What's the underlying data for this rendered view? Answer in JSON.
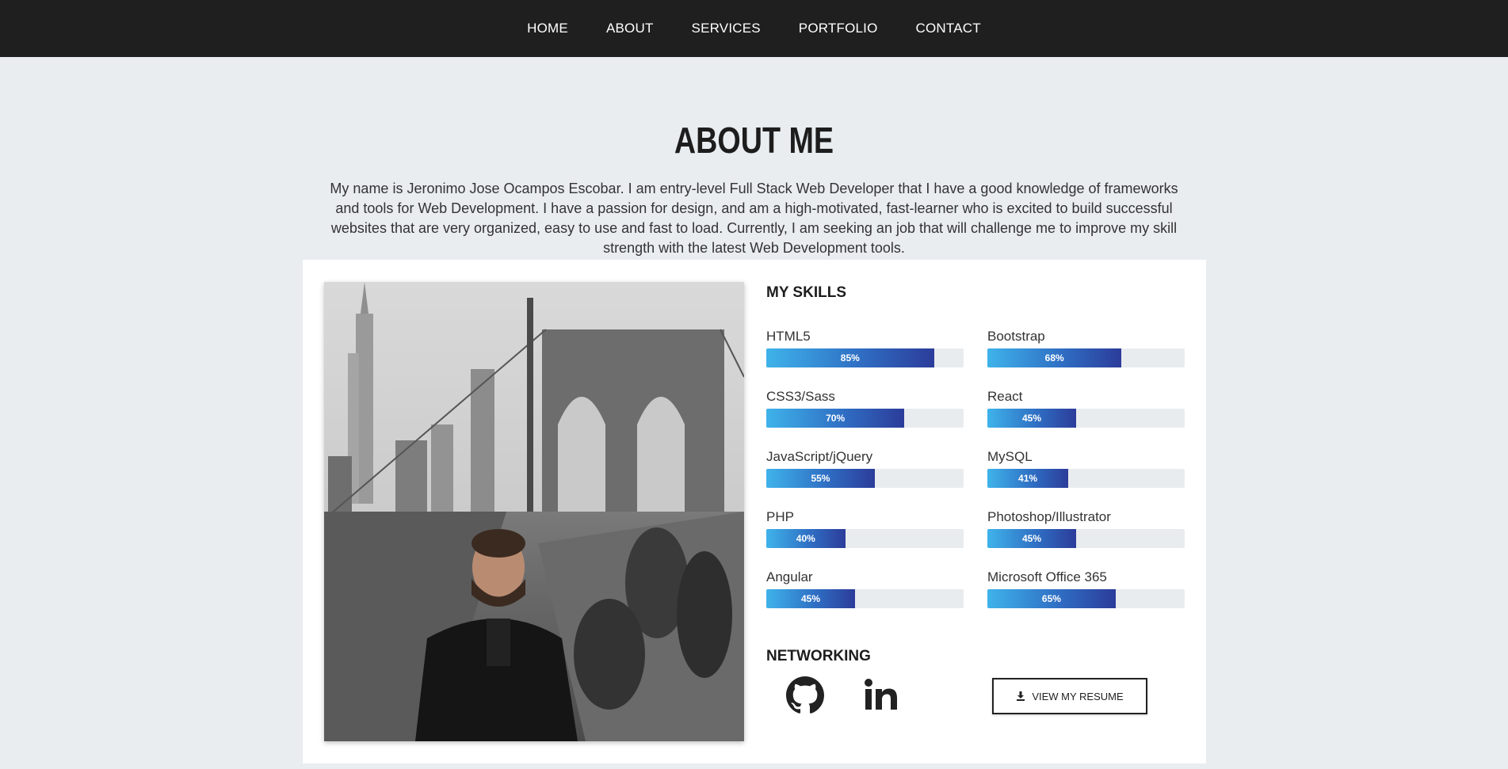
{
  "nav": {
    "items": [
      "HOME",
      "ABOUT",
      "SERVICES",
      "PORTFOLIO",
      "CONTACT"
    ]
  },
  "about": {
    "title": "ABOUT ME",
    "intro": "My name is Jeronimo Jose Ocampos Escobar. I am entry-level Full Stack Web Developer that I have a good knowledge of frameworks and tools for Web Development. I have a passion for design, and am a high-motivated, fast-learner who is excited to build successful websites that are very organized, easy to use and fast to load. Currently, I am seeking an job that will challenge me to improve my skill strength with the latest Web Development tools."
  },
  "skills": {
    "title": "MY SKILLS",
    "items": [
      {
        "name": "HTML5",
        "percent": 85,
        "label": "85%"
      },
      {
        "name": "Bootstrap",
        "percent": 68,
        "label": "68%"
      },
      {
        "name": "CSS3/Sass",
        "percent": 70,
        "label": "70%"
      },
      {
        "name": "React",
        "percent": 45,
        "label": "45%"
      },
      {
        "name": "JavaScript/jQuery",
        "percent": 55,
        "label": "55%"
      },
      {
        "name": "MySQL",
        "percent": 41,
        "label": "41%"
      },
      {
        "name": "PHP",
        "percent": 40,
        "label": "40%"
      },
      {
        "name": "Photoshop/Illustrator",
        "percent": 45,
        "label": "45%"
      },
      {
        "name": "Angular",
        "percent": 45,
        "label": "45%"
      },
      {
        "name": "Microsoft Office 365",
        "percent": 65,
        "label": "65%"
      }
    ]
  },
  "networking": {
    "title": "NETWORKING",
    "icons": [
      "github-icon",
      "linkedin-icon"
    ],
    "resume_label": "VIEW MY RESUME",
    "resume_icon": "download-icon"
  },
  "colors": {
    "nav_bg": "#1f1f1f",
    "page_bg": "#e9edf0",
    "bar_start": "#3fb3ea",
    "bar_end": "#2c3c9a",
    "bar_track": "#e9ecef"
  }
}
